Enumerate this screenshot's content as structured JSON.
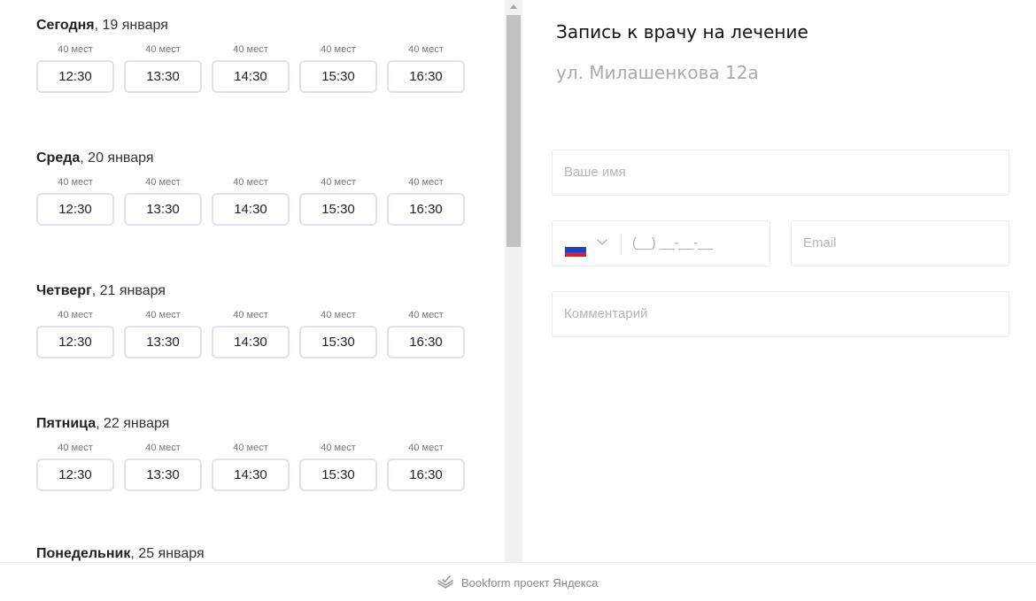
{
  "schedule": {
    "days": [
      {
        "weekday": "Сегодня",
        "date": ", 19 января",
        "slots": [
          {
            "seats": "40 мест",
            "time": "12:30"
          },
          {
            "seats": "40 мест",
            "time": "13:30"
          },
          {
            "seats": "40 мест",
            "time": "14:30"
          },
          {
            "seats": "40 мест",
            "time": "15:30"
          },
          {
            "seats": "40 мест",
            "time": "16:30"
          }
        ]
      },
      {
        "weekday": "Среда",
        "date": ", 20 января",
        "slots": [
          {
            "seats": "40 мест",
            "time": "12:30"
          },
          {
            "seats": "40 мест",
            "time": "13:30"
          },
          {
            "seats": "40 мест",
            "time": "14:30"
          },
          {
            "seats": "40 мест",
            "time": "15:30"
          },
          {
            "seats": "40 мест",
            "time": "16:30"
          }
        ]
      },
      {
        "weekday": "Четверг",
        "date": ", 21 января",
        "slots": [
          {
            "seats": "40 мест",
            "time": "12:30"
          },
          {
            "seats": "40 мест",
            "time": "13:30"
          },
          {
            "seats": "40 мест",
            "time": "14:30"
          },
          {
            "seats": "40 мест",
            "time": "15:30"
          },
          {
            "seats": "40 мест",
            "time": "16:30"
          }
        ]
      },
      {
        "weekday": "Пятница",
        "date": ", 22 января",
        "slots": [
          {
            "seats": "40 мест",
            "time": "12:30"
          },
          {
            "seats": "40 мест",
            "time": "13:30"
          },
          {
            "seats": "40 мест",
            "time": "14:30"
          },
          {
            "seats": "40 мест",
            "time": "15:30"
          },
          {
            "seats": "40 мест",
            "time": "16:30"
          }
        ]
      },
      {
        "weekday": "Понедельник",
        "date": ", 25 января",
        "slots": []
      }
    ]
  },
  "form": {
    "title": "Запись к врачу на лечение",
    "address": "ул. Милашенкова 12а",
    "name_placeholder": "Ваше имя",
    "phone_mask": "(__) __-__-__",
    "email_placeholder": "Email",
    "comment_placeholder": "Комментарий",
    "phone_country_flag_icon": "russia-flag-icon"
  },
  "footer": {
    "text": "Bookform проект Яндекса",
    "logo_icon": "bookform-logo-icon"
  },
  "colors": {
    "slot_border": "#dfe2ea",
    "muted_text": "#aaaaaa",
    "scrollbar_thumb": "#c1c1c1"
  }
}
